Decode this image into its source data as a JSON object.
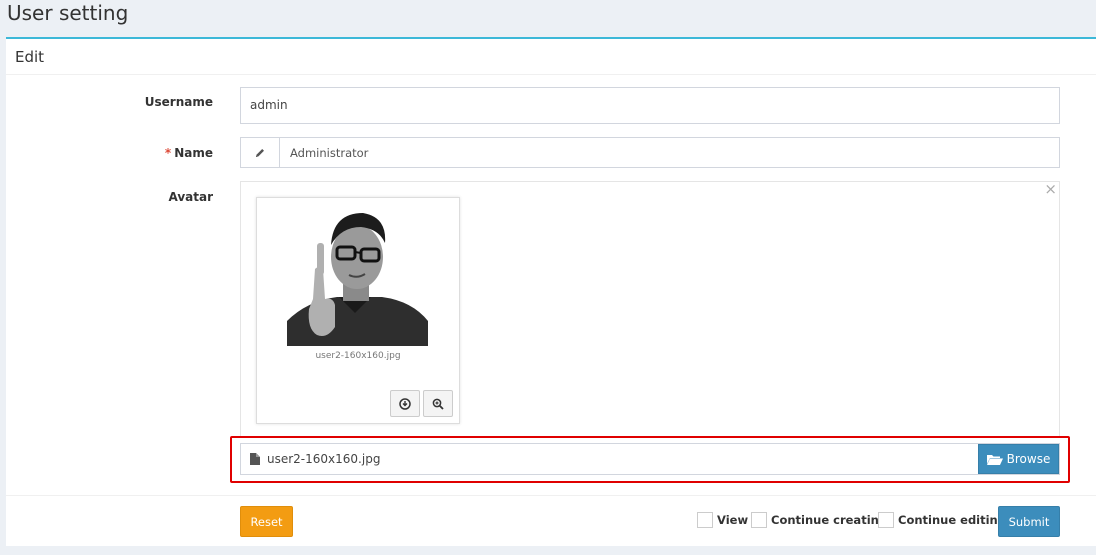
{
  "page": {
    "title": "User setting"
  },
  "box": {
    "title": "Edit"
  },
  "form": {
    "username": {
      "label": "Username",
      "value": "admin"
    },
    "name": {
      "required_mark": "*",
      "label": "Name",
      "value": "Administrator",
      "icon": "pencil-icon"
    },
    "avatar": {
      "label": "Avatar",
      "close_glyph": "×",
      "preview_caption": "user2-160x160.jpg",
      "file_name": "user2-160x160.jpg",
      "browse_label": "Browse"
    }
  },
  "footer": {
    "reset_label": "Reset",
    "submit_label": "Submit",
    "checks": [
      {
        "label": "View"
      },
      {
        "label": "Continue creating"
      },
      {
        "label": "Continue editing"
      }
    ]
  },
  "colors": {
    "accent": "#3c8dbc",
    "warning": "#f39c12",
    "box_border_top": "#3cb8d8",
    "highlight": "#e00000"
  }
}
